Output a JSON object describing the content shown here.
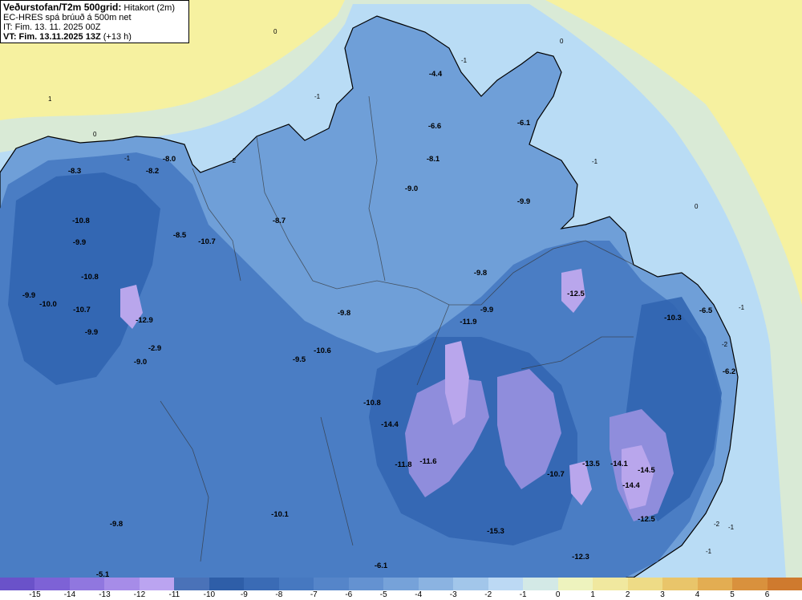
{
  "header": {
    "title_bold": "Veðurstofan/T2m 500grid:",
    "title_rest": " Hitakort (2m)",
    "model_line": "EC-HRES spá brúuð á 500m net",
    "init_line": "IT: Fim. 13. 11. 2025 00Z",
    "valid_bold": "VT: Fim. 13.11.2025 13Z",
    "valid_rest": " (+13 h)"
  },
  "colors": {
    "sea_warm": "#f6f1a0",
    "sea_zero": "#d9ead6",
    "sea_cold": "#b9dcf5",
    "land_minus4": "#6f9fd8",
    "land_minus7": "#4a7dc4",
    "land_minus9": "#2f63b0",
    "land_minus11": "#8f8ddc",
    "land_minus13": "#b9a6ec",
    "border": "#000000"
  },
  "legend": {
    "ticks": [
      "-15",
      "-14",
      "-13",
      "-12",
      "-11",
      "-10",
      "-9",
      "-8",
      "-7",
      "-6",
      "-5",
      "-4",
      "-3",
      "-2",
      "-1",
      "0",
      "1",
      "2",
      "3",
      "4",
      "5",
      "6"
    ],
    "colors": [
      "#6a52c9",
      "#7d62d6",
      "#9077df",
      "#a68ce8",
      "#bba4f0",
      "#4a72b8",
      "#2e5ea8",
      "#3a6bb5",
      "#4678c0",
      "#5585c9",
      "#6492d1",
      "#76a2d9",
      "#8bb3e1",
      "#a2c6ea",
      "#bcd9f4",
      "#d3e9e6",
      "#eef3be",
      "#f0e89f",
      "#eedb86",
      "#e9c56a",
      "#e3ad52",
      "#d9913d",
      "#cf7a2e"
    ]
  },
  "contour_labels": {
    "sea": [
      "0",
      "1",
      "-1",
      "0",
      "-1",
      "0",
      "-1",
      "-2",
      "-1",
      "-2",
      "-1",
      "-1",
      "-2",
      "0",
      "-1"
    ],
    "values": [
      "-8.3",
      "-8.2",
      "-8.0",
      "-10.8",
      "-9.9",
      "-8.5",
      "-10.7",
      "-10.8",
      "-9.9",
      "-10.0",
      "-10.7",
      "-9.9",
      "-12.9",
      "-2.9",
      "-9.0",
      "-8.7",
      "-4.4",
      "-6.6",
      "-8.1",
      "-9.0",
      "-9.9",
      "-6.1",
      "-9.8",
      "-9.8",
      "-9.9",
      "-11.9",
      "-12.5",
      "-10.6",
      "-9.5",
      "-10.8",
      "-14.4",
      "-11.8",
      "-11.6",
      "-10.7",
      "-13.5",
      "-14.1",
      "-14.5",
      "-14.4",
      "-12.5",
      "-15.3",
      "-12.3",
      "-10.1",
      "-9.8",
      "-5.1",
      "-6.1",
      "-10.3",
      "-6.5",
      "-6.2"
    ]
  }
}
